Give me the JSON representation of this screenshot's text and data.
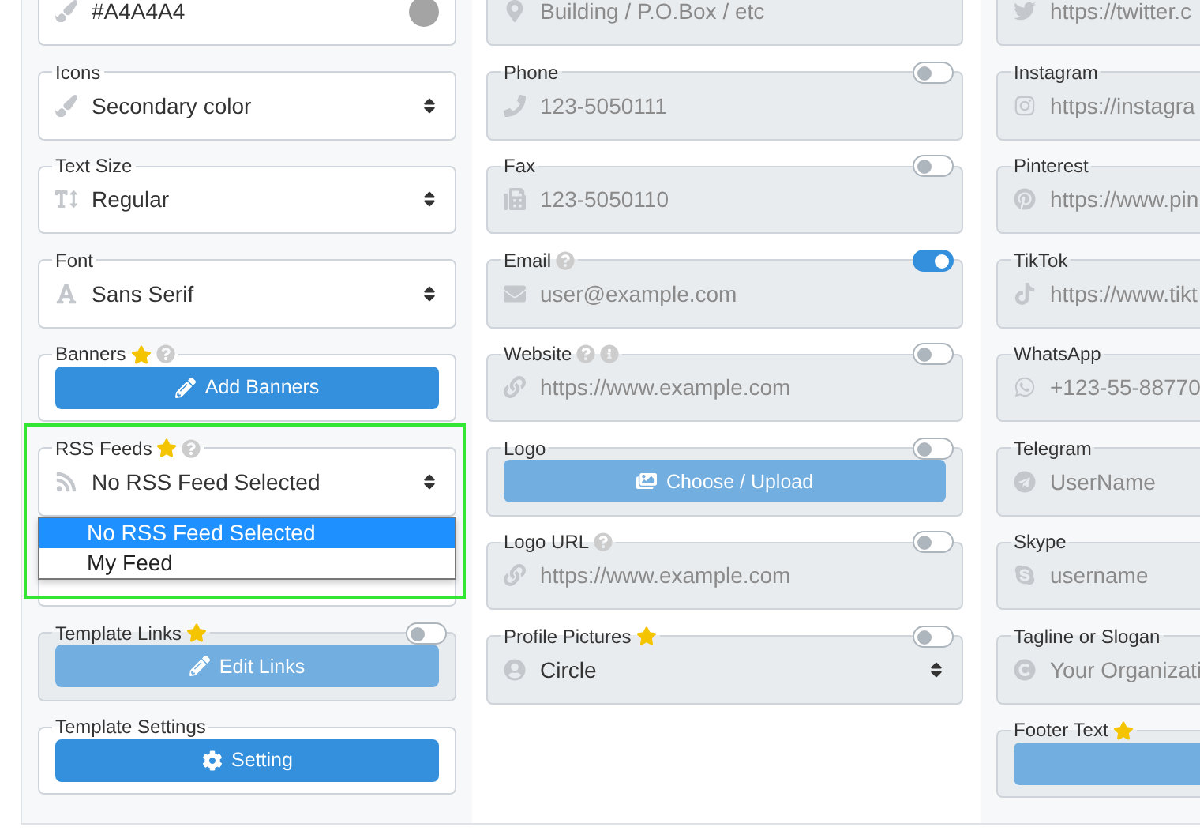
{
  "columns": [
    {
      "fields": [
        {
          "kind": "color",
          "value": "#A4A4A4",
          "color": "#a4a4a4"
        },
        {
          "kind": "select",
          "label": "Icons",
          "value": "Secondary color"
        },
        {
          "kind": "select",
          "label": "Text Size",
          "value": "Regular"
        },
        {
          "kind": "select",
          "label": "Font",
          "value": "Sans Serif"
        },
        {
          "kind": "button",
          "label": "Banners",
          "star": true,
          "help": true,
          "button": "Add Banners"
        },
        {
          "kind": "select",
          "label": "RSS Feeds",
          "star": true,
          "help": true,
          "value": "No RSS Feed Selected",
          "highlighted": true,
          "expanded": true,
          "options": [
            {
              "label": "No RSS Feed Selected",
              "selected": true
            },
            {
              "label": "My Feed",
              "selected": false
            }
          ]
        },
        {
          "kind": "blank"
        },
        {
          "kind": "button",
          "label": "Template Links",
          "star": true,
          "toggle": false,
          "disabled": true,
          "button": "Edit Links"
        },
        {
          "kind": "button",
          "label": "Template Settings",
          "button": "Setting"
        }
      ]
    },
    {
      "fields": [
        {
          "kind": "input",
          "placeholder": "Building / P.O.Box / etc",
          "disabled": true
        },
        {
          "kind": "input",
          "label": "Phone",
          "toggle": false,
          "disabled": true,
          "placeholder": "123-5050111"
        },
        {
          "kind": "input",
          "label": "Fax",
          "toggle": false,
          "disabled": true,
          "placeholder": "123-5050110"
        },
        {
          "kind": "input",
          "label": "Email",
          "help": true,
          "toggle": true,
          "disabled": true,
          "placeholder": "user@example.com"
        },
        {
          "kind": "input",
          "label": "Website",
          "help": true,
          "info": true,
          "toggle": false,
          "disabled": true,
          "placeholder": "https://www.example.com"
        },
        {
          "kind": "button",
          "label": "Logo",
          "toggle": false,
          "disabled": true,
          "button": "Choose / Upload"
        },
        {
          "kind": "input",
          "label": "Logo URL",
          "help": true,
          "toggle": false,
          "disabled": true,
          "placeholder": "https://www.example.com"
        },
        {
          "kind": "select",
          "label": "Profile Pictures",
          "star": true,
          "toggle": false,
          "disabled": true,
          "value": "Circle"
        }
      ]
    },
    {
      "fields": [
        {
          "kind": "input",
          "disabled": true,
          "placeholder": "https://twitter.c"
        },
        {
          "kind": "input",
          "label": "Instagram",
          "disabled": true,
          "placeholder": "https://instagra"
        },
        {
          "kind": "input",
          "label": "Pinterest",
          "disabled": true,
          "placeholder": "https://www.pin"
        },
        {
          "kind": "input",
          "label": "TikTok",
          "disabled": true,
          "placeholder": "https://www.tikt"
        },
        {
          "kind": "input",
          "label": "WhatsApp",
          "disabled": true,
          "placeholder": "+123-55-88770"
        },
        {
          "kind": "input",
          "label": "Telegram",
          "disabled": true,
          "placeholder": "UserName"
        },
        {
          "kind": "input",
          "label": "Skype",
          "disabled": true,
          "placeholder": "username"
        },
        {
          "kind": "input",
          "label": "Tagline or Slogan",
          "disabled": true,
          "placeholder": "Your Organizati"
        },
        {
          "kind": "button",
          "label": "Footer Text",
          "star": true,
          "disabled": true
        }
      ]
    }
  ]
}
